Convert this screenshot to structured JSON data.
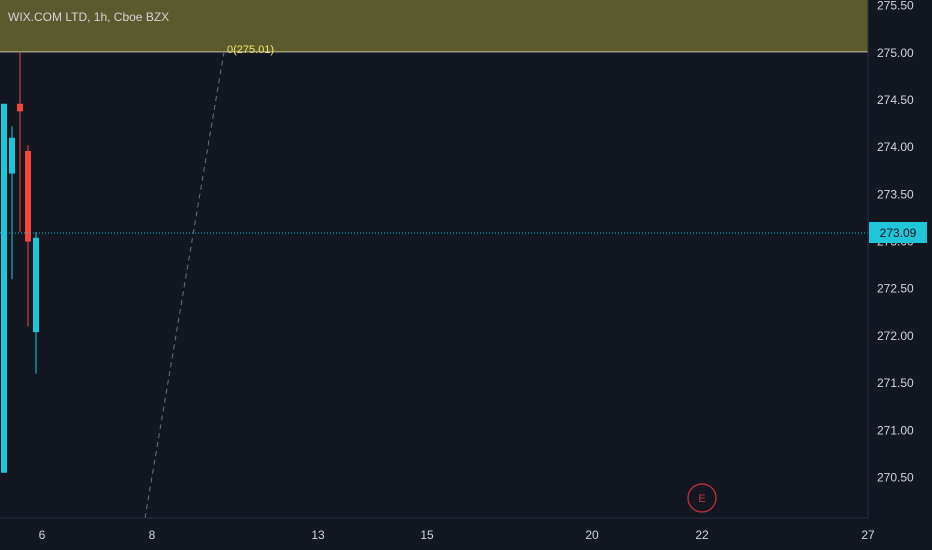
{
  "header": {
    "title": "WIX.COM LTD, 1h, Cboe BZX"
  },
  "colors": {
    "background": "#131722",
    "band": "#5b5a2c",
    "up": "#22c4d8",
    "down": "#f2473d",
    "price_line": "#22c4d8",
    "fib_label": "#f5e36b",
    "earnings": "#c9333d",
    "axis_text": "#d1d4dc"
  },
  "price_label": "273.09",
  "fib_label": "0(275.01)",
  "earnings_marker": "E",
  "chart_data": {
    "type": "candlestick",
    "title": "WIX.COM LTD, 1h, Cboe BZX",
    "ylim": [
      270.07,
      275.56
    ],
    "y_ticks": [
      "270.50",
      "271.00",
      "271.50",
      "272.00",
      "272.50",
      "273.00",
      "273.50",
      "274.00",
      "274.50",
      "275.00",
      "275.50"
    ],
    "x_ticks": [
      "6",
      "8",
      "13",
      "15",
      "20",
      "22",
      "27"
    ],
    "last_price": 273.09,
    "fib_level": 275.01,
    "candles": [
      {
        "open": 270.55,
        "high": 274.46,
        "low": 270.55,
        "close": 274.46
      },
      {
        "open": 273.72,
        "high": 274.22,
        "low": 272.6,
        "close": 274.1
      },
      {
        "open": 274.46,
        "high": 275.01,
        "low": 273.1,
        "close": 274.38
      },
      {
        "open": 273.96,
        "high": 274.02,
        "low": 272.1,
        "close": 273.0
      },
      {
        "open": 272.04,
        "high": 273.1,
        "low": 271.6,
        "close": 273.04
      }
    ]
  }
}
